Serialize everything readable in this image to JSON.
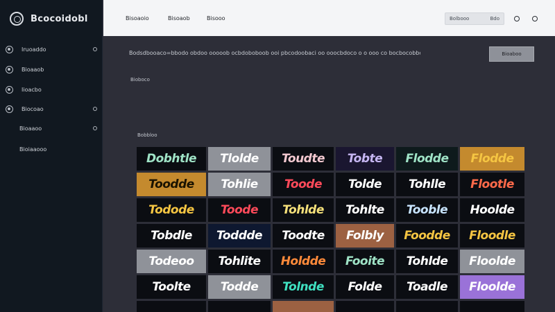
{
  "app": {
    "brand": "Bcocoidobl"
  },
  "sidebar": {
    "items": [
      {
        "label": "Iruoaddo",
        "sub": false,
        "caret": true
      },
      {
        "label": "Bioaaob",
        "sub": false,
        "caret": false
      },
      {
        "label": "Iioacbo",
        "sub": false,
        "caret": false
      },
      {
        "label": "Biocoao",
        "sub": false,
        "caret": true
      },
      {
        "label": "Bioaaoo",
        "sub": true,
        "caret": true
      },
      {
        "label": "Bioiaaooo",
        "sub": true,
        "caret": false
      }
    ]
  },
  "topbar": {
    "links": [
      "Bisoaoio",
      "Bisoaob",
      "Bisooo"
    ],
    "search": {
      "left": "Bolbooo",
      "right": "Bdo"
    }
  },
  "main": {
    "intro": "Bodsdbooaco=bbodo obdoo ooooob ocbdoboboob ooi pbcodoobaci oo ooocbdoco o o ooo co bocbocobboooo ooo",
    "cta": "Bioaboo",
    "subheading": "Bioboco",
    "section_label": "Bobbloo"
  },
  "tiles": {
    "colors": {
      "black": "#0b0d12",
      "gray": "#8f9299",
      "navy": "#0e1830",
      "gold": "#c48a2e",
      "brown": "#9c6142",
      "purple": "#9a72d8",
      "white": "#ffffff",
      "mint": "#9fe3c6",
      "red": "#ff4a5a",
      "yellow": "#f5c542",
      "lavender": "#c6b6f2",
      "teal": "#3fe0c0",
      "orange": "#ff8a3a"
    },
    "rows": [
      [
        {
          "text": "Dobhtle",
          "bg": "#0b0d12",
          "fg": "#9fe3c6"
        },
        {
          "text": "Tlolde",
          "bg": "#8f9299",
          "fg": "#ffffff"
        },
        {
          "text": "Toudte",
          "bg": "#0b0d12",
          "fg": "#f3c9d0"
        },
        {
          "text": "Tobte",
          "bg": "#1a1630",
          "fg": "#c6b6f2"
        },
        {
          "text": "Flodde",
          "bg": "#0e1a1c",
          "fg": "#9fe3c6"
        },
        {
          "text": "Flodde",
          "bg": "#c48a2e",
          "fg": "#f5c542"
        }
      ],
      [
        {
          "text": "Toodde",
          "bg": "#c48a2e",
          "fg": "#1a1300"
        },
        {
          "text": "Tohlie",
          "bg": "#8f9299",
          "fg": "#ffffff"
        },
        {
          "text": "Toode",
          "bg": "#0b0d12",
          "fg": "#ff4a5a"
        },
        {
          "text": "Tolde",
          "bg": "#0b0d12",
          "fg": "#ffffff"
        },
        {
          "text": "Tohlle",
          "bg": "#0b0d12",
          "fg": "#ffffff"
        },
        {
          "text": "Flootle",
          "bg": "#0b0d12",
          "fg": "#ff6a4a"
        }
      ],
      [
        {
          "text": "Todode",
          "bg": "#0b0d12",
          "fg": "#f5c542"
        },
        {
          "text": "Toode",
          "bg": "#0b0d12",
          "fg": "#ff4a5a"
        },
        {
          "text": "Tohlde",
          "bg": "#0b0d12",
          "fg": "#f5e07a"
        },
        {
          "text": "Tohlte",
          "bg": "#0b0d12",
          "fg": "#ffffff"
        },
        {
          "text": "Tooble",
          "bg": "#0b0d12",
          "fg": "#c8e4ff"
        },
        {
          "text": "Hoolde",
          "bg": "#0b0d12",
          "fg": "#ffffff"
        }
      ],
      [
        {
          "text": "Tobdle",
          "bg": "#0b0d12",
          "fg": "#ffffff"
        },
        {
          "text": "Toddde",
          "bg": "#0e1830",
          "fg": "#ffffff"
        },
        {
          "text": "Toodte",
          "bg": "#0b0d12",
          "fg": "#ffffff"
        },
        {
          "text": "Folbly",
          "bg": "#9c6142",
          "fg": "#ffffff"
        },
        {
          "text": "Foodde",
          "bg": "#0b0d12",
          "fg": "#f5c542"
        },
        {
          "text": "Floodle",
          "bg": "#0b0d12",
          "fg": "#f5c542"
        }
      ],
      [
        {
          "text": "Todeoo",
          "bg": "#8f9299",
          "fg": "#ffffff"
        },
        {
          "text": "Tohlite",
          "bg": "#0b0d12",
          "fg": "#ffffff"
        },
        {
          "text": "Holdde",
          "bg": "#0b0d12",
          "fg": "#ff8a3a"
        },
        {
          "text": "Fooite",
          "bg": "#0b0d12",
          "fg": "#9fe3c6"
        },
        {
          "text": "Tohlde",
          "bg": "#0b0d12",
          "fg": "#ffffff"
        },
        {
          "text": "Floolde",
          "bg": "#8f9299",
          "fg": "#ffffff"
        }
      ],
      [
        {
          "text": "Toolte",
          "bg": "#0b0d12",
          "fg": "#ffffff"
        },
        {
          "text": "Todde",
          "bg": "#8f9299",
          "fg": "#ffffff"
        },
        {
          "text": "Tolnde",
          "bg": "#0b0d12",
          "fg": "#3fe0c0"
        },
        {
          "text": "Folde",
          "bg": "#0b0d12",
          "fg": "#ffffff"
        },
        {
          "text": "Toadle",
          "bg": "#0b0d12",
          "fg": "#ffffff"
        },
        {
          "text": "Floolde",
          "bg": "#9a72d8",
          "fg": "#ffffff"
        }
      ],
      [
        {
          "text": "",
          "bg": "#0b0d12",
          "fg": "#ffffff"
        },
        {
          "text": "",
          "bg": "#0b0d12",
          "fg": "#ffffff"
        },
        {
          "text": "",
          "bg": "#9c6142",
          "fg": "#ffffff"
        },
        {
          "text": "",
          "bg": "#0b0d12",
          "fg": "#ffffff"
        },
        {
          "text": "",
          "bg": "#0b0d12",
          "fg": "#ffffff"
        },
        {
          "text": "",
          "bg": "#0b0d12",
          "fg": "#ffffff"
        }
      ]
    ]
  }
}
